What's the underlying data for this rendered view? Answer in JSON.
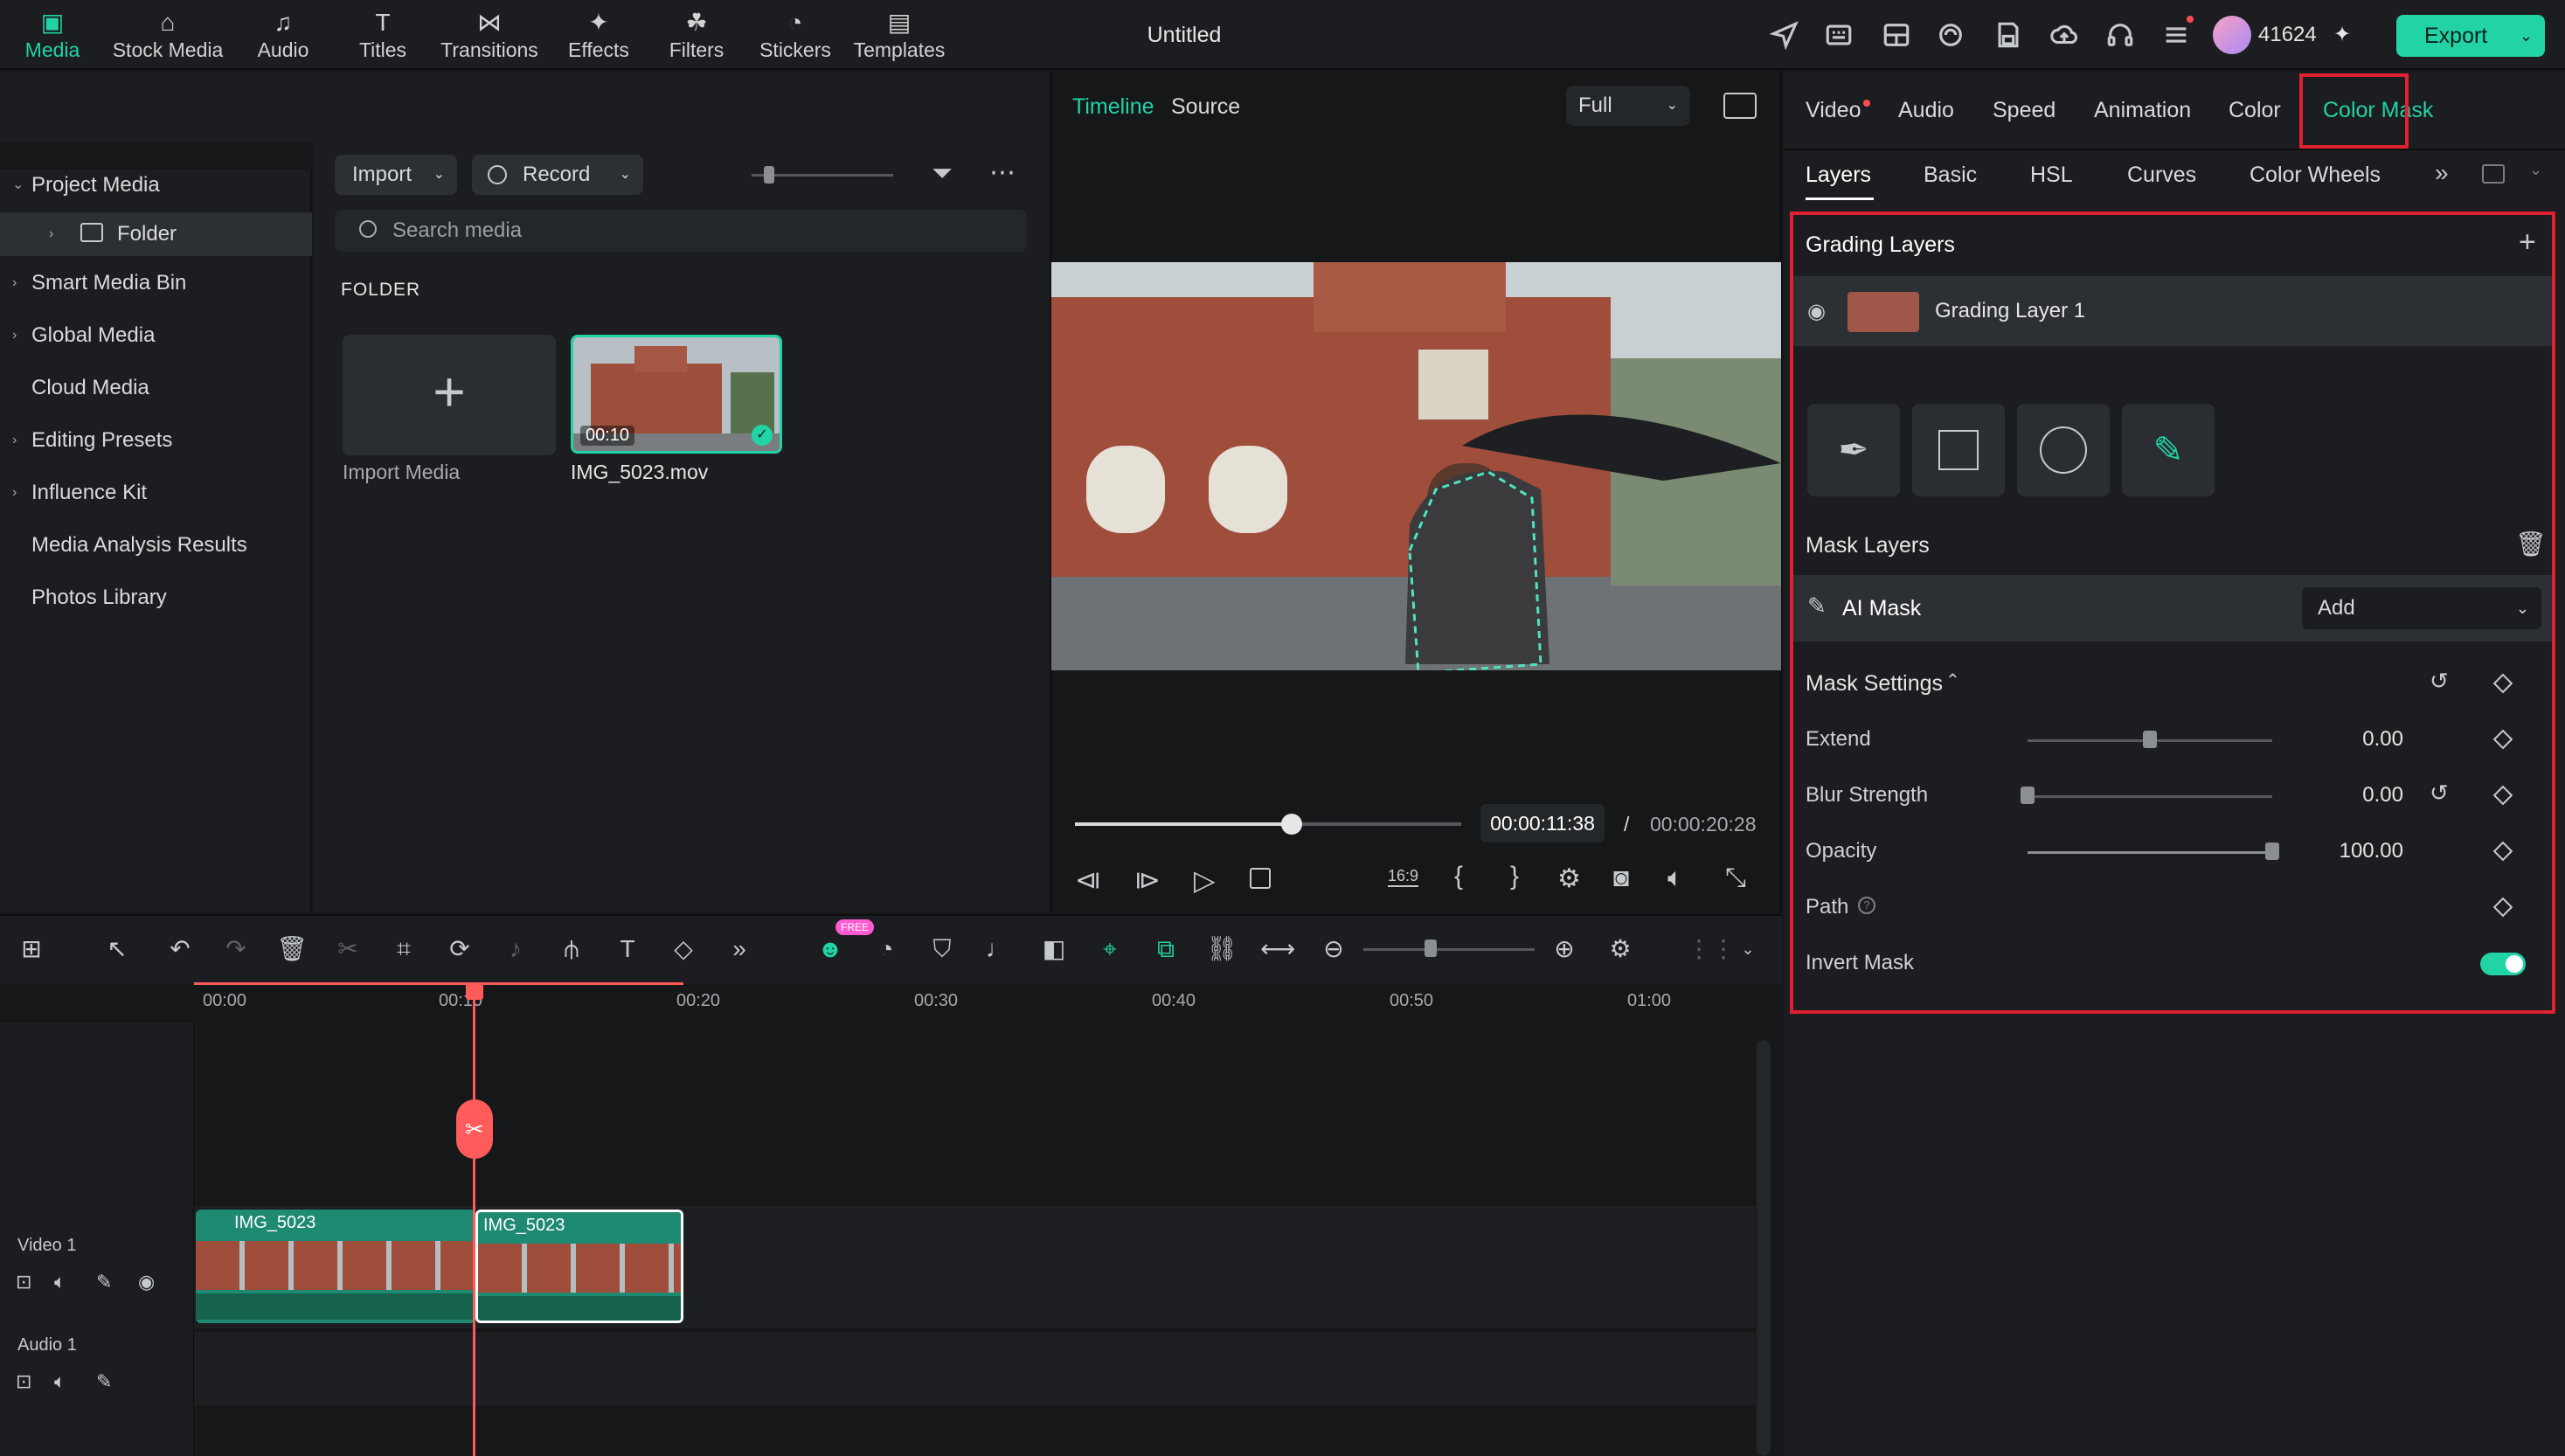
{
  "window": {
    "title": "Untitled"
  },
  "topbar": {
    "credits": "41624",
    "spark": "✦",
    "export_label": "Export"
  },
  "media_tabs": [
    {
      "label": "Media",
      "icon": "media-icon",
      "active": true
    },
    {
      "label": "Stock Media",
      "icon": "stock-media-icon"
    },
    {
      "label": "Audio",
      "icon": "music-note-icon"
    },
    {
      "label": "Titles",
      "icon": "titles-icon"
    },
    {
      "label": "Transitions",
      "icon": "transitions-icon"
    },
    {
      "label": "Effects",
      "icon": "effects-icon"
    },
    {
      "label": "Filters",
      "icon": "filters-icon"
    },
    {
      "label": "Stickers",
      "icon": "stickers-icon"
    },
    {
      "label": "Templates",
      "icon": "templates-icon"
    }
  ],
  "sidebar": {
    "items": [
      {
        "label": "Project Media",
        "expanded": true
      },
      {
        "label": "Folder",
        "selected": true
      },
      {
        "label": "Smart Media Bin"
      },
      {
        "label": "Global Media"
      },
      {
        "label": "Cloud Media"
      },
      {
        "label": "Editing Presets"
      },
      {
        "label": "Influence Kit"
      },
      {
        "label": "Media Analysis Results"
      },
      {
        "label": "Photos Library"
      }
    ]
  },
  "media": {
    "import_label": "Import",
    "record_label": "Record",
    "search_placeholder": "Search media",
    "section": "FOLDER",
    "import_tile_label": "Import Media",
    "clip": {
      "name": "IMG_5023.mov",
      "duration": "00:10"
    }
  },
  "preview": {
    "tab_timeline": "Timeline",
    "tab_source": "Source",
    "quality": "Full",
    "current_time": "00:00:11:38",
    "separator": "/",
    "total_time": "00:00:20:28",
    "progress": 0.56,
    "aspect_label": "16:9"
  },
  "right_panel": {
    "tabs": [
      "Video",
      "Audio",
      "Speed",
      "Animation",
      "Color",
      "Color Mask"
    ],
    "active_tab": "Color Mask",
    "subtabs": [
      "Layers",
      "Basic",
      "HSL",
      "Curves",
      "Color Wheels"
    ],
    "active_subtab": "Layers",
    "grading_layers_title": "Grading Layers",
    "grading_layer_name": "Grading Layer 1",
    "mask_layers_title": "Mask Layers",
    "ai_mask_label": "AI Mask",
    "ai_mask_mode": "Add",
    "mask_settings_title": "Mask Settings",
    "settings": [
      {
        "label": "Extend",
        "value": "0.00",
        "fraction": 0.5
      },
      {
        "label": "Blur Strength",
        "value": "0.00",
        "fraction": 0.0
      },
      {
        "label": "Opacity",
        "value": "100.00",
        "fraction": 1.0
      }
    ],
    "path_label": "Path",
    "invert_label": "Invert Mask",
    "invert_on": true
  },
  "timeline": {
    "ticks": [
      "00:00",
      "00:10",
      "00:20",
      "00:30",
      "00:40",
      "00:50",
      "01:00"
    ],
    "badge": "FREE",
    "tracks": [
      {
        "label": "Video 1"
      },
      {
        "label": "Audio 1"
      }
    ],
    "clips": [
      {
        "name": "IMG_5023"
      },
      {
        "name": "IMG_5023"
      }
    ]
  },
  "colors": {
    "accent": "#22d3a6",
    "highlight": "#e0212f",
    "playhead": "#ff5b5b"
  }
}
